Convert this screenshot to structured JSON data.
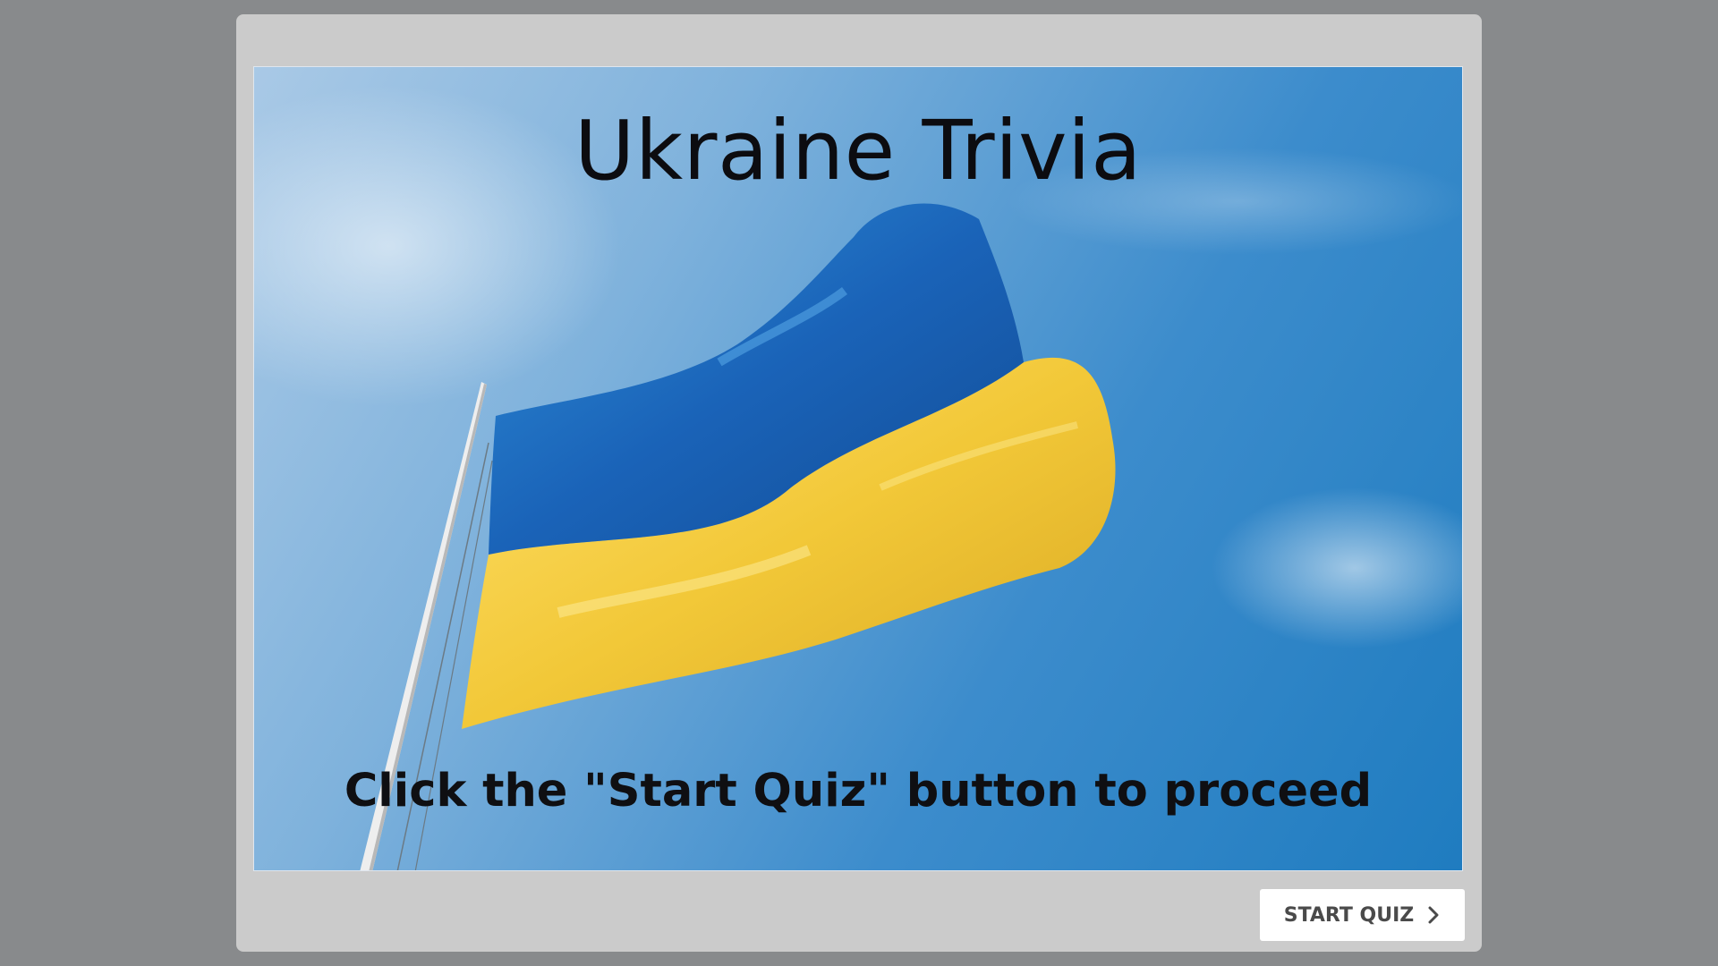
{
  "slide": {
    "title": "Ukraine Trivia",
    "instruction": "Click the \"Start Quiz\" button to proceed",
    "image": "ukraine-flag-photo"
  },
  "controls": {
    "start_label": "START QUIZ",
    "start_icon": "chevron-right-icon"
  },
  "colors": {
    "frame": "#cbcbcb",
    "backdrop": "#888a8c",
    "flag_blue": "#1a63b8",
    "flag_yellow": "#f2c838"
  }
}
